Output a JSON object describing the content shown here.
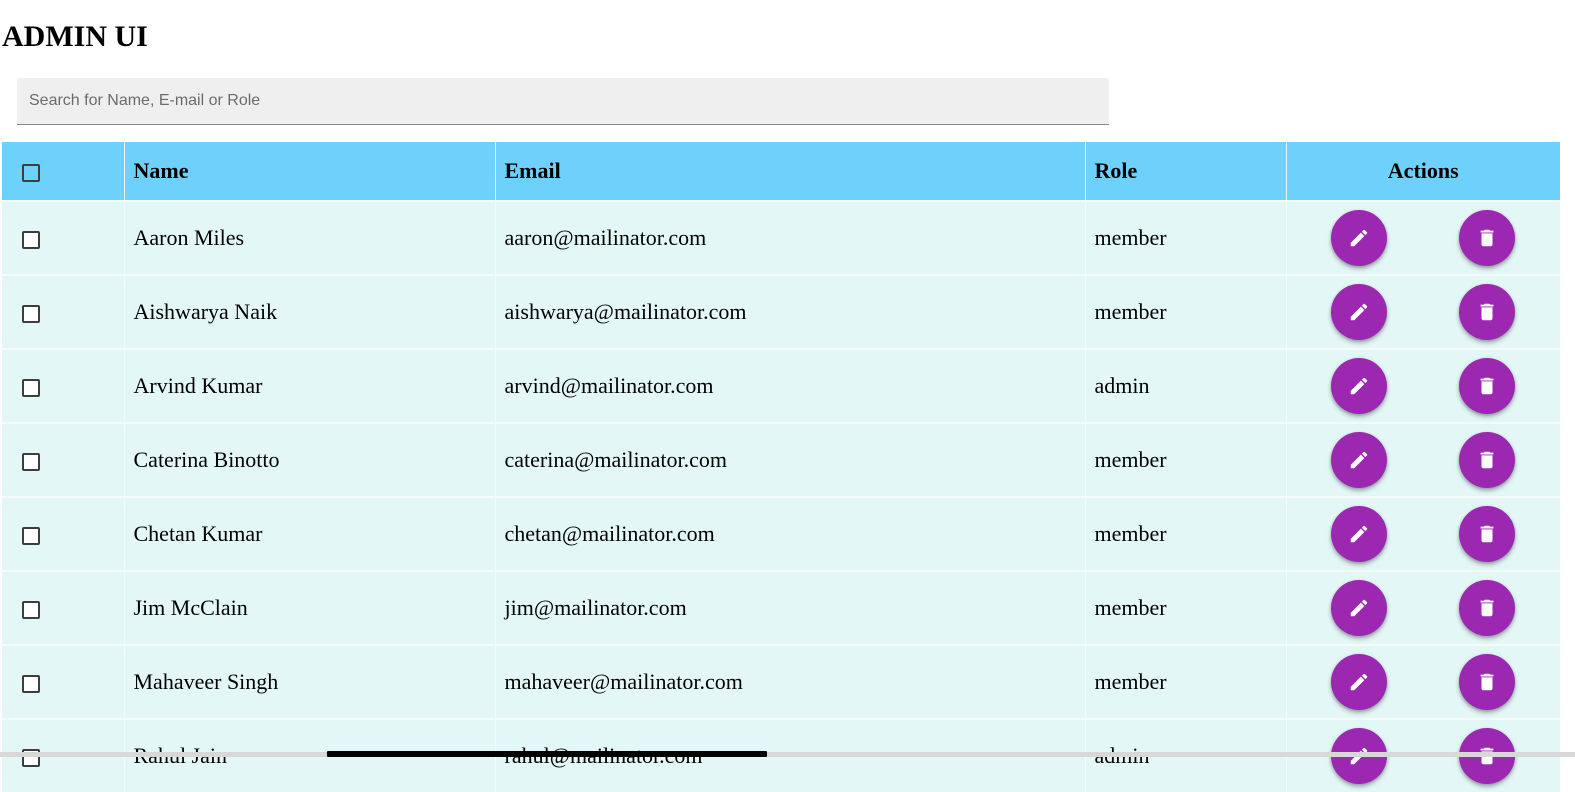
{
  "app": {
    "title": "ADMIN UI"
  },
  "search": {
    "placeholder": "Search for Name, E-mail or Role",
    "value": ""
  },
  "table": {
    "columns": {
      "name": "Name",
      "email": "Email",
      "role": "Role",
      "actions": "Actions"
    },
    "rows": [
      {
        "name": "Aaron Miles",
        "email": "aaron@mailinator.com",
        "role": "member"
      },
      {
        "name": "Aishwarya Naik",
        "email": "aishwarya@mailinator.com",
        "role": "member"
      },
      {
        "name": "Arvind Kumar",
        "email": "arvind@mailinator.com",
        "role": "admin"
      },
      {
        "name": "Caterina Binotto",
        "email": "caterina@mailinator.com",
        "role": "member"
      },
      {
        "name": "Chetan Kumar",
        "email": "chetan@mailinator.com",
        "role": "member"
      },
      {
        "name": "Jim McClain",
        "email": "jim@mailinator.com",
        "role": "member"
      },
      {
        "name": "Mahaveer Singh",
        "email": "mahaveer@mailinator.com",
        "role": "member"
      },
      {
        "name": "Rahul Jain",
        "email": "rahul@mailinator.com",
        "role": "admin"
      }
    ],
    "actions": {
      "edit_icon": "pencil-icon",
      "delete_icon": "trash-icon"
    }
  },
  "colors": {
    "header_bg": "#6ed1fb",
    "row_bg": "#e3f8f6",
    "action_button": "#9c27b0",
    "search_bg": "#efefef"
  }
}
